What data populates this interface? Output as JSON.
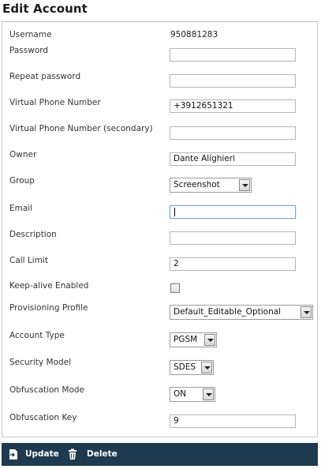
{
  "page": {
    "title": "Edit Account"
  },
  "form": {
    "username_label": "Username",
    "username_value": "950881283",
    "password_label": "Password",
    "password_value": "",
    "repeat_password_label": "Repeat password",
    "repeat_password_value": "",
    "virtual_phone_label": "Virtual Phone Number",
    "virtual_phone_value": "+3912651321",
    "virtual_phone2_label": "Virtual Phone Number (secondary)",
    "virtual_phone2_value": "",
    "owner_label": "Owner",
    "owner_value": "Dante Alighieri",
    "group_label": "Group",
    "group_value": "Screenshot",
    "email_label": "Email",
    "email_value": "",
    "description_label": "Description",
    "description_value": "",
    "call_limit_label": "Call Limit",
    "call_limit_value": "2",
    "keepalive_label": "Keep-alive Enabled",
    "keepalive_checked": false,
    "provisioning_label": "Provisioning Profile",
    "provisioning_value": "Default_Editable_Optional",
    "account_type_label": "Account Type",
    "account_type_value": "PGSM",
    "security_label": "Security Model",
    "security_value": "SDES",
    "obfuscation_mode_label": "Obfuscation Mode",
    "obfuscation_mode_value": "ON",
    "obfuscation_key_label": "Obfuscation Key",
    "obfuscation_key_value": "9"
  },
  "footer": {
    "update_label": "Update",
    "delete_label": "Delete",
    "update_icon": "save-update-icon",
    "delete_icon": "trash-icon"
  },
  "colors": {
    "footer_bg": "#1e3a4f",
    "focus_border": "#7fa7c9"
  }
}
